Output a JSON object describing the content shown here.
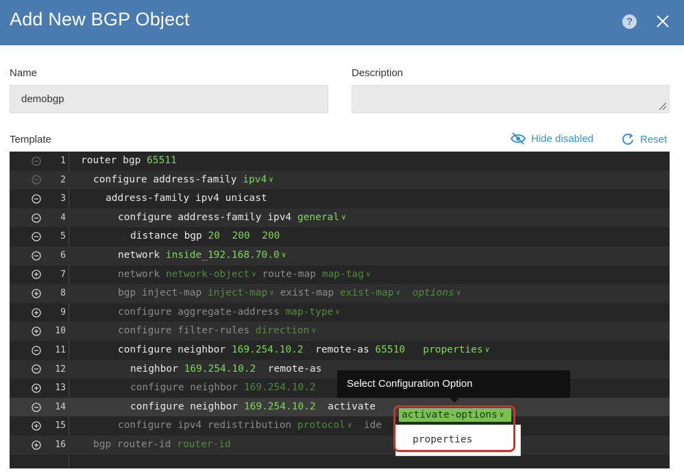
{
  "dialog": {
    "title": "Add New BGP Object",
    "help_icon": "question-icon",
    "close_icon": "close-icon"
  },
  "form": {
    "name_label": "Name",
    "name_value": "demobgp",
    "description_label": "Description",
    "description_value": "",
    "template_label": "Template",
    "hide_disabled_label": "Hide disabled",
    "reset_label": "Reset"
  },
  "colors": {
    "header": "#4a7bb0",
    "link": "#3a8fd0",
    "keyword_green": "#7ed957",
    "highlight_red": "#c0392b"
  },
  "editor": {
    "lines": [
      {
        "num": "1",
        "toggle": "minus",
        "disabled": false,
        "tokens": [
          {
            "t": "router bgp "
          },
          {
            "t": "65511",
            "g": true
          }
        ]
      },
      {
        "num": "2",
        "toggle": "minus",
        "disabled": false,
        "tokens": [
          {
            "t": "configure address-family "
          },
          {
            "t": "ipv4",
            "g": true,
            "dd": true
          }
        ]
      },
      {
        "num": "3",
        "toggle": "minus",
        "disabled": false,
        "tokens": [
          {
            "t": "address-family ipv4 unicast"
          }
        ]
      },
      {
        "num": "4",
        "toggle": "minus",
        "disabled": false,
        "tokens": [
          {
            "t": "configure address-family ipv4 "
          },
          {
            "t": "general",
            "g": true,
            "dd": true
          }
        ]
      },
      {
        "num": "5",
        "toggle": "minus",
        "disabled": false,
        "tokens": [
          {
            "t": "distance bgp "
          },
          {
            "t": "20",
            "g": true
          },
          {
            "t": "  "
          },
          {
            "t": "200",
            "g": true
          },
          {
            "t": "  "
          },
          {
            "t": "200",
            "g": true
          }
        ]
      },
      {
        "num": "6",
        "toggle": "minus",
        "disabled": false,
        "tokens": [
          {
            "t": "network "
          },
          {
            "t": "inside_192.168.70.0",
            "g": true,
            "dd": true
          }
        ]
      },
      {
        "num": "7",
        "toggle": "plus",
        "disabled": true,
        "tokens": [
          {
            "t": "network "
          },
          {
            "t": "network-object",
            "g": true,
            "dd": true
          },
          {
            "t": " route-map "
          },
          {
            "t": "map-tag",
            "g": true,
            "dd": true
          }
        ]
      },
      {
        "num": "8",
        "toggle": "plus",
        "disabled": true,
        "tokens": [
          {
            "t": "bgp inject-map "
          },
          {
            "t": "inject-map",
            "g": true,
            "dd": true
          },
          {
            "t": " exist-map "
          },
          {
            "t": "exist-map",
            "g": true,
            "dd": true
          },
          {
            "t": "  "
          },
          {
            "t": "options",
            "g": true,
            "dd": true,
            "it": true
          }
        ]
      },
      {
        "num": "9",
        "toggle": "plus",
        "disabled": true,
        "tokens": [
          {
            "t": "configure aggregate-address "
          },
          {
            "t": "map-type",
            "g": true,
            "dd": true
          }
        ]
      },
      {
        "num": "10",
        "toggle": "plus",
        "disabled": true,
        "tokens": [
          {
            "t": "configure filter-rules "
          },
          {
            "t": "direction",
            "g": true,
            "dd": true
          }
        ]
      },
      {
        "num": "11",
        "toggle": "minus",
        "disabled": false,
        "tokens": [
          {
            "t": "configure neighbor "
          },
          {
            "t": "169.254.10.2",
            "g": true
          },
          {
            "t": "  remote-as "
          },
          {
            "t": "65510",
            "g": true
          },
          {
            "t": "   "
          },
          {
            "t": "properties",
            "g": true,
            "dd": true
          }
        ]
      },
      {
        "num": "12",
        "toggle": "minus",
        "disabled": false,
        "tokens": [
          {
            "t": "neighbor "
          },
          {
            "t": "169.254.10.2",
            "g": true
          },
          {
            "t": "  remote-as "
          }
        ]
      },
      {
        "num": "13",
        "toggle": "plus",
        "disabled": true,
        "tokens": [
          {
            "t": "configure neighbor "
          },
          {
            "t": "169.254.10.2",
            "g": true
          }
        ]
      },
      {
        "num": "14",
        "toggle": "minus",
        "disabled": false,
        "tokens": [
          {
            "t": "configure neighbor "
          },
          {
            "t": "169.254.10.2",
            "g": true
          },
          {
            "t": "  activate "
          }
        ]
      },
      {
        "num": "15",
        "toggle": "plus",
        "disabled": true,
        "tokens": [
          {
            "t": "configure ipv4 redistribution "
          },
          {
            "t": "protocol",
            "g": true,
            "dd": true
          },
          {
            "t": "  ide"
          }
        ]
      },
      {
        "num": "16",
        "toggle": "plus",
        "disabled": true,
        "tokens": [
          {
            "t": "bgp router-id "
          },
          {
            "t": "router-id",
            "g": true
          }
        ]
      }
    ]
  },
  "popup": {
    "tooltip_text": "Select Configuration Option",
    "selected_option": "activate-options",
    "options": [
      "properties"
    ]
  }
}
